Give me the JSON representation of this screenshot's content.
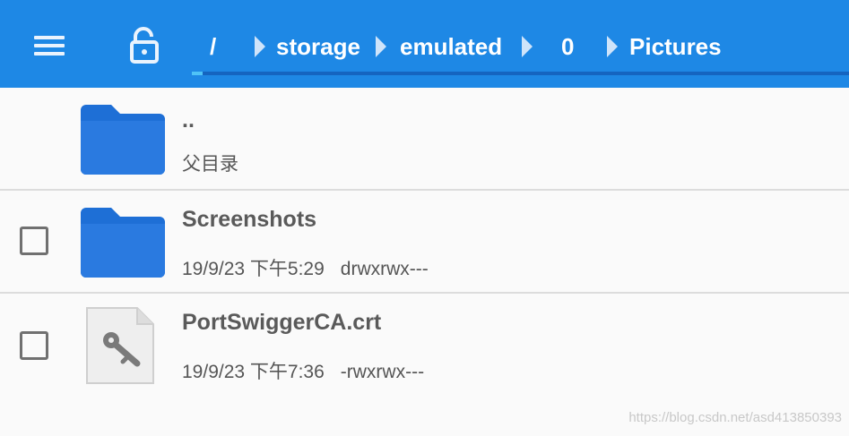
{
  "colors": {
    "appbar": "#1e88e5",
    "folder": "#1e6fd6",
    "text_primary": "#5a5a5a",
    "text_secondary": "#555555"
  },
  "header": {
    "menu_icon": "hamburger-menu-icon",
    "lock_icon": "unlocked-padlock-icon",
    "breadcrumbs": [
      {
        "label": "/"
      },
      {
        "label": "storage"
      },
      {
        "label": "emulated"
      },
      {
        "label": "0"
      },
      {
        "label": "Pictures"
      }
    ]
  },
  "files": {
    "parent": {
      "name": "..",
      "subtitle": "父目录",
      "icon": "folder-icon"
    },
    "items": [
      {
        "name": "Screenshots",
        "date": "19/9/23 下午5:29",
        "permissions": "drwxrwx---",
        "icon": "folder-icon",
        "checked": false
      },
      {
        "name": "PortSwiggerCA.crt",
        "date": "19/9/23 下午7:36",
        "permissions": "-rwxrwx---",
        "icon": "key-file-icon",
        "checked": false
      }
    ]
  },
  "watermark": "https://blog.csdn.net/asd413850393"
}
